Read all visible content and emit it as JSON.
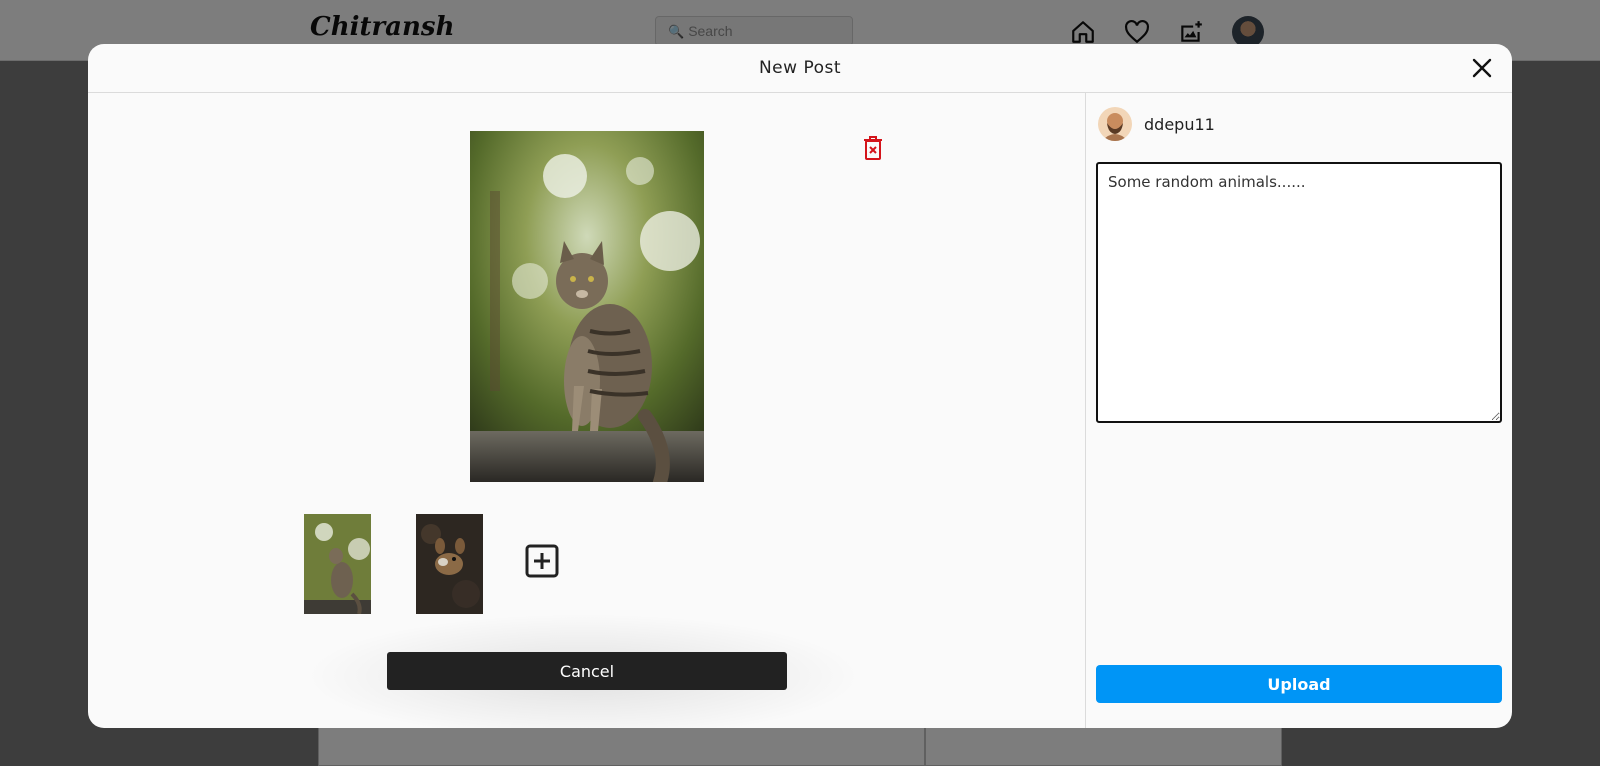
{
  "app": {
    "brand": "Chitransh",
    "search_placeholder": "Search"
  },
  "nav_icons": [
    "home-icon",
    "heart-icon",
    "add-photo-icon",
    "avatar"
  ],
  "modal": {
    "title": "New Post",
    "close_icon": "close-icon",
    "delete_icon": "delete-icon",
    "add_icon": "add-image-icon",
    "thumbnails": [
      "cat-photo",
      "animal-photo"
    ],
    "cancel_label": "Cancel",
    "user": {
      "username": "ddepu11"
    },
    "caption_value": "Some random animals......",
    "upload_label": "Upload"
  },
  "colors": {
    "accent": "#0095f6",
    "danger": "#d4141b",
    "cancel_bg": "#222222"
  }
}
